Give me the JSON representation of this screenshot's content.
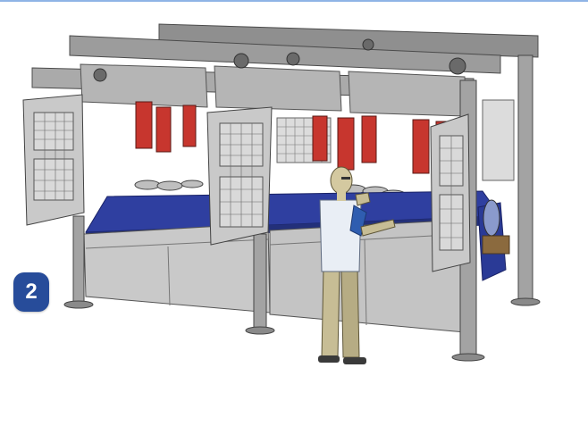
{
  "step": {
    "number": "2",
    "color": "#274c9a"
  },
  "scene": {
    "brand_label_left": "",
    "brand_label_center": "",
    "colors": {
      "frame": "#9a9a9a",
      "panel": "#c9c9c9",
      "belt": "#2f3fa0",
      "actuator": "#c7362e",
      "worker_shirt": "#e9eef5",
      "worker_sleeve": "#2f5db0",
      "worker_pants": "#c7bd95"
    }
  }
}
